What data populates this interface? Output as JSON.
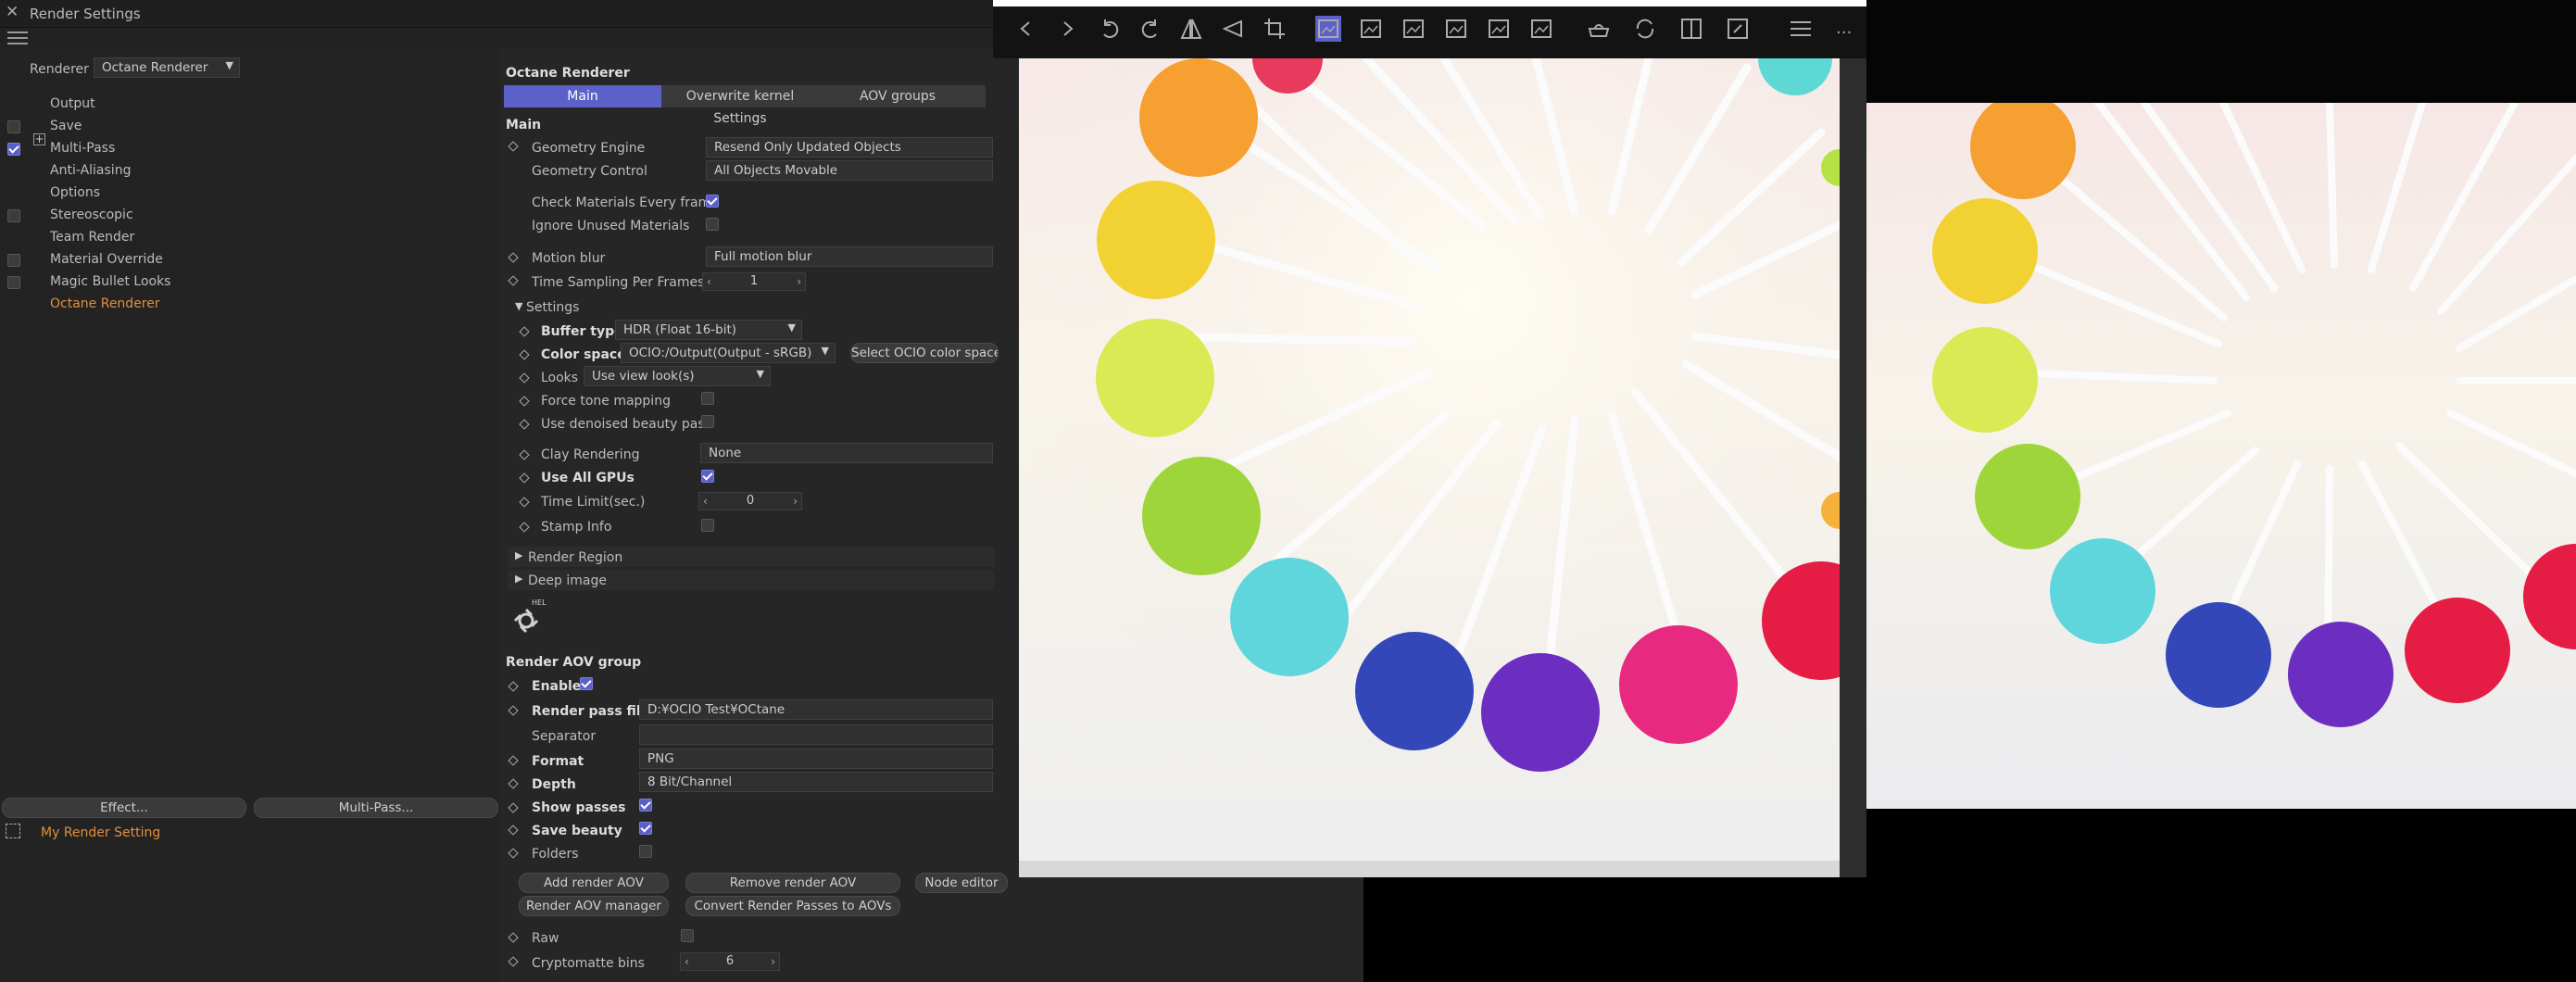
{
  "window": {
    "title": "Render Settings"
  },
  "renderer": {
    "label": "Renderer",
    "value": "Octane Renderer"
  },
  "tree": [
    {
      "label": "Output",
      "checkbox": false,
      "checked": false
    },
    {
      "label": "Save",
      "checkbox": true,
      "checked": false
    },
    {
      "label": "Multi-Pass",
      "checkbox": true,
      "checked": true
    },
    {
      "label": "Anti-Aliasing",
      "checkbox": false,
      "checked": false
    },
    {
      "label": "Options",
      "checkbox": false,
      "checked": false
    },
    {
      "label": "Stereoscopic",
      "checkbox": true,
      "checked": false
    },
    {
      "label": "Team Render",
      "checkbox": false,
      "checked": false
    },
    {
      "label": "Material Override",
      "checkbox": true,
      "checked": false
    },
    {
      "label": "Magic Bullet Looks",
      "checkbox": true,
      "checked": false
    },
    {
      "label": "Octane Renderer",
      "checkbox": false,
      "checked": false
    }
  ],
  "left_buttons": {
    "effect": "Effect...",
    "multipass": "Multi-Pass..."
  },
  "render_setting": "My Render Setting",
  "octane": {
    "title": "Octane Renderer",
    "tabs": [
      "Main",
      "Overwrite kernel Settings",
      "AOV groups"
    ],
    "main_header": "Main",
    "geometry_engine": {
      "label": "Geometry Engine",
      "value": "Resend Only Updated Objects"
    },
    "geometry_control": {
      "label": "Geometry Control",
      "value": "All Objects Movable"
    },
    "check_materials": {
      "label": "Check Materials Every frame",
      "checked": true
    },
    "ignore_unused": {
      "label": "Ignore Unused Materials",
      "checked": false
    },
    "motion_blur": {
      "label": "Motion blur",
      "value": "Full motion blur"
    },
    "time_sampling": {
      "label": "Time Sampling Per Frames",
      "value": "1"
    },
    "settings_header": "Settings",
    "buffer_type": {
      "label": "Buffer type",
      "value": "HDR (Float 16-bit)"
    },
    "color_space": {
      "label": "Color space",
      "value": "OCIO:/Output(Output - sRGB)",
      "button": "Select OCIO color space"
    },
    "looks": {
      "label": "Looks",
      "value": "Use view look(s)"
    },
    "force_tone": {
      "label": "Force tone mapping",
      "checked": false
    },
    "denoised": {
      "label": "Use denoised beauty pass",
      "checked": false
    },
    "clay": {
      "label": "Clay Rendering",
      "value": "None"
    },
    "all_gpus": {
      "label": "Use All GPUs",
      "checked": true
    },
    "time_limit": {
      "label": "Time Limit(sec.)",
      "value": "0"
    },
    "stamp_info": {
      "label": "Stamp Info",
      "checked": false
    },
    "render_region": "Render Region",
    "deep_image": "Deep image",
    "help": "HELP"
  },
  "aov": {
    "header": "Render AOV group",
    "enable": {
      "label": "Enable",
      "checked": true
    },
    "pass_file": {
      "label": "Render pass file",
      "value": "D:¥OCIO Test¥OCtane"
    },
    "separator": {
      "label": "Separator",
      "value": ""
    },
    "format": {
      "label": "Format",
      "value": "PNG"
    },
    "depth": {
      "label": "Depth",
      "value": "8 Bit/Channel"
    },
    "show_passes": {
      "label": "Show passes",
      "checked": true
    },
    "save_beauty": {
      "label": "Save beauty",
      "checked": true
    },
    "folders": {
      "label": "Folders",
      "checked": false
    },
    "buttons": [
      "Add render AOV",
      "Remove render AOV",
      "Node editor",
      "Render AOV manager",
      "Convert Render Passes to AOVs"
    ],
    "raw": {
      "label": "Raw",
      "checked": false
    },
    "crypto": {
      "label": "Cryptomatte bins",
      "value": "6"
    }
  },
  "viewer": {
    "toolbar_icons": [
      "back-icon",
      "forward-icon",
      "undo-icon",
      "redo-icon",
      "flip-horizontal-icon",
      "flip-vertical-icon",
      "crop-icon",
      "image-view-1-icon",
      "image-lock-icon",
      "image-view-2-icon",
      "image-view-3-icon",
      "image-view-4-icon",
      "image-view-5-icon",
      "snapshot-icon",
      "refresh-icon",
      "split-icon",
      "fit-icon",
      "menu-icon",
      "more-icon"
    ],
    "more": "..."
  },
  "colors": {
    "accent": "#5b61c9",
    "active_text": "#e08f3b",
    "panel": "#232323"
  }
}
